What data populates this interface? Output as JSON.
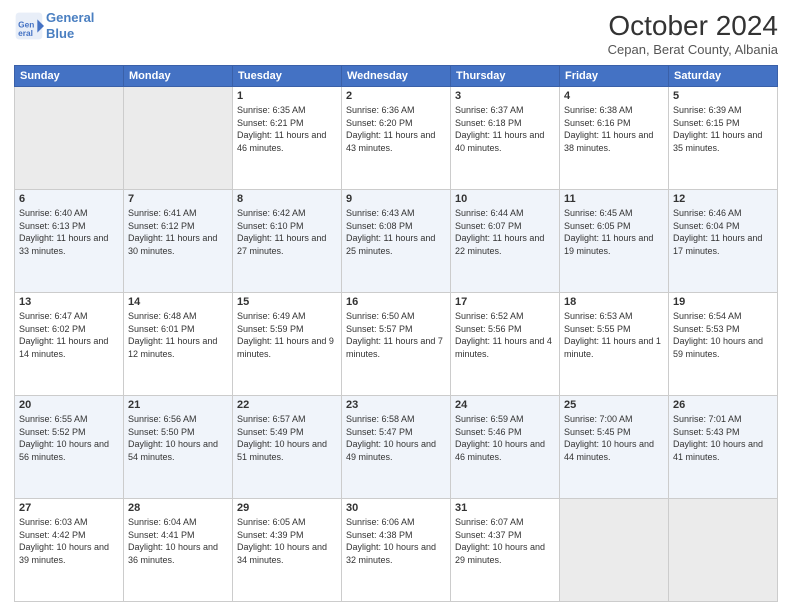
{
  "logo": {
    "line1": "General",
    "line2": "Blue"
  },
  "title": "October 2024",
  "location": "Cepan, Berat County, Albania",
  "days_of_week": [
    "Sunday",
    "Monday",
    "Tuesday",
    "Wednesday",
    "Thursday",
    "Friday",
    "Saturday"
  ],
  "weeks": [
    {
      "days": [
        {
          "num": "",
          "info": "",
          "empty": true
        },
        {
          "num": "",
          "info": "",
          "empty": true
        },
        {
          "num": "1",
          "info": "Sunrise: 6:35 AM\nSunset: 6:21 PM\nDaylight: 11 hours and 46 minutes.",
          "empty": false
        },
        {
          "num": "2",
          "info": "Sunrise: 6:36 AM\nSunset: 6:20 PM\nDaylight: 11 hours and 43 minutes.",
          "empty": false
        },
        {
          "num": "3",
          "info": "Sunrise: 6:37 AM\nSunset: 6:18 PM\nDaylight: 11 hours and 40 minutes.",
          "empty": false
        },
        {
          "num": "4",
          "info": "Sunrise: 6:38 AM\nSunset: 6:16 PM\nDaylight: 11 hours and 38 minutes.",
          "empty": false
        },
        {
          "num": "5",
          "info": "Sunrise: 6:39 AM\nSunset: 6:15 PM\nDaylight: 11 hours and 35 minutes.",
          "empty": false
        }
      ]
    },
    {
      "days": [
        {
          "num": "6",
          "info": "Sunrise: 6:40 AM\nSunset: 6:13 PM\nDaylight: 11 hours and 33 minutes.",
          "empty": false
        },
        {
          "num": "7",
          "info": "Sunrise: 6:41 AM\nSunset: 6:12 PM\nDaylight: 11 hours and 30 minutes.",
          "empty": false
        },
        {
          "num": "8",
          "info": "Sunrise: 6:42 AM\nSunset: 6:10 PM\nDaylight: 11 hours and 27 minutes.",
          "empty": false
        },
        {
          "num": "9",
          "info": "Sunrise: 6:43 AM\nSunset: 6:08 PM\nDaylight: 11 hours and 25 minutes.",
          "empty": false
        },
        {
          "num": "10",
          "info": "Sunrise: 6:44 AM\nSunset: 6:07 PM\nDaylight: 11 hours and 22 minutes.",
          "empty": false
        },
        {
          "num": "11",
          "info": "Sunrise: 6:45 AM\nSunset: 6:05 PM\nDaylight: 11 hours and 19 minutes.",
          "empty": false
        },
        {
          "num": "12",
          "info": "Sunrise: 6:46 AM\nSunset: 6:04 PM\nDaylight: 11 hours and 17 minutes.",
          "empty": false
        }
      ]
    },
    {
      "days": [
        {
          "num": "13",
          "info": "Sunrise: 6:47 AM\nSunset: 6:02 PM\nDaylight: 11 hours and 14 minutes.",
          "empty": false
        },
        {
          "num": "14",
          "info": "Sunrise: 6:48 AM\nSunset: 6:01 PM\nDaylight: 11 hours and 12 minutes.",
          "empty": false
        },
        {
          "num": "15",
          "info": "Sunrise: 6:49 AM\nSunset: 5:59 PM\nDaylight: 11 hours and 9 minutes.",
          "empty": false
        },
        {
          "num": "16",
          "info": "Sunrise: 6:50 AM\nSunset: 5:57 PM\nDaylight: 11 hours and 7 minutes.",
          "empty": false
        },
        {
          "num": "17",
          "info": "Sunrise: 6:52 AM\nSunset: 5:56 PM\nDaylight: 11 hours and 4 minutes.",
          "empty": false
        },
        {
          "num": "18",
          "info": "Sunrise: 6:53 AM\nSunset: 5:55 PM\nDaylight: 11 hours and 1 minute.",
          "empty": false
        },
        {
          "num": "19",
          "info": "Sunrise: 6:54 AM\nSunset: 5:53 PM\nDaylight: 10 hours and 59 minutes.",
          "empty": false
        }
      ]
    },
    {
      "days": [
        {
          "num": "20",
          "info": "Sunrise: 6:55 AM\nSunset: 5:52 PM\nDaylight: 10 hours and 56 minutes.",
          "empty": false
        },
        {
          "num": "21",
          "info": "Sunrise: 6:56 AM\nSunset: 5:50 PM\nDaylight: 10 hours and 54 minutes.",
          "empty": false
        },
        {
          "num": "22",
          "info": "Sunrise: 6:57 AM\nSunset: 5:49 PM\nDaylight: 10 hours and 51 minutes.",
          "empty": false
        },
        {
          "num": "23",
          "info": "Sunrise: 6:58 AM\nSunset: 5:47 PM\nDaylight: 10 hours and 49 minutes.",
          "empty": false
        },
        {
          "num": "24",
          "info": "Sunrise: 6:59 AM\nSunset: 5:46 PM\nDaylight: 10 hours and 46 minutes.",
          "empty": false
        },
        {
          "num": "25",
          "info": "Sunrise: 7:00 AM\nSunset: 5:45 PM\nDaylight: 10 hours and 44 minutes.",
          "empty": false
        },
        {
          "num": "26",
          "info": "Sunrise: 7:01 AM\nSunset: 5:43 PM\nDaylight: 10 hours and 41 minutes.",
          "empty": false
        }
      ]
    },
    {
      "days": [
        {
          "num": "27",
          "info": "Sunrise: 6:03 AM\nSunset: 4:42 PM\nDaylight: 10 hours and 39 minutes.",
          "empty": false
        },
        {
          "num": "28",
          "info": "Sunrise: 6:04 AM\nSunset: 4:41 PM\nDaylight: 10 hours and 36 minutes.",
          "empty": false
        },
        {
          "num": "29",
          "info": "Sunrise: 6:05 AM\nSunset: 4:39 PM\nDaylight: 10 hours and 34 minutes.",
          "empty": false
        },
        {
          "num": "30",
          "info": "Sunrise: 6:06 AM\nSunset: 4:38 PM\nDaylight: 10 hours and 32 minutes.",
          "empty": false
        },
        {
          "num": "31",
          "info": "Sunrise: 6:07 AM\nSunset: 4:37 PM\nDaylight: 10 hours and 29 minutes.",
          "empty": false
        },
        {
          "num": "",
          "info": "",
          "empty": true
        },
        {
          "num": "",
          "info": "",
          "empty": true
        }
      ]
    }
  ]
}
